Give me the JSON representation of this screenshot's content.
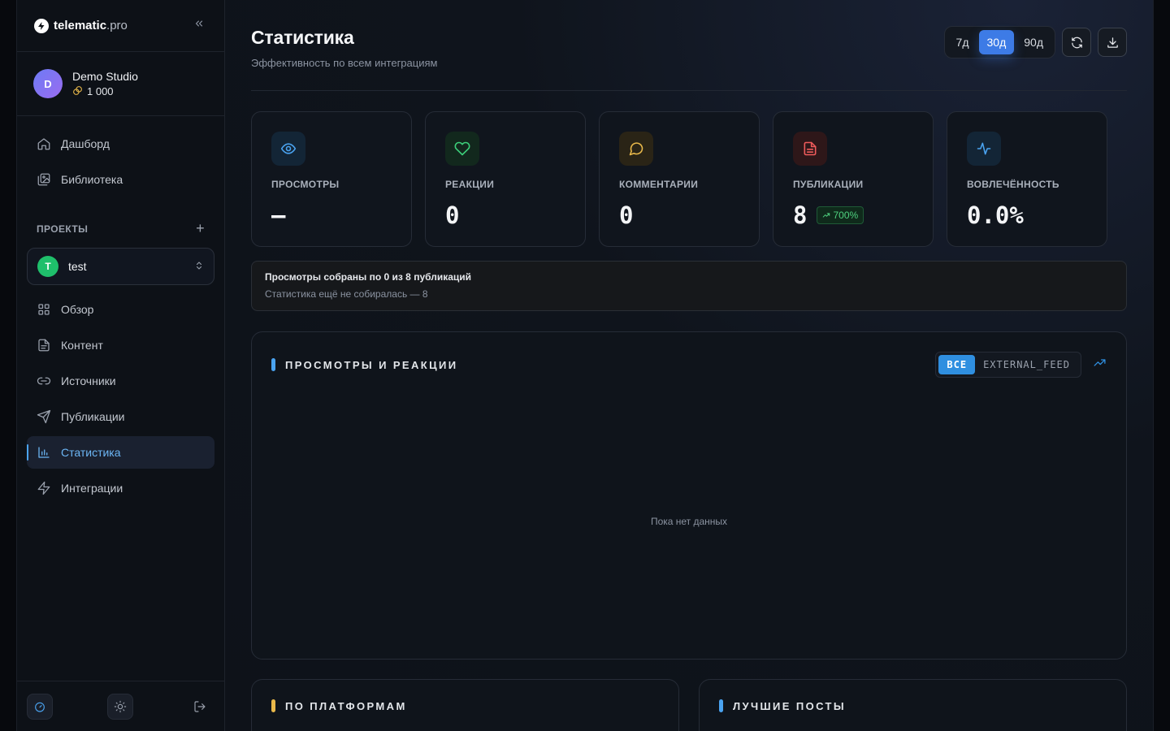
{
  "brand": {
    "name": "telematic",
    "suffix": ".pro"
  },
  "studio": {
    "initial": "D",
    "name": "Demo Studio",
    "credits": "1 000"
  },
  "nav_top": [
    {
      "label": "Дашборд",
      "icon": "home-icon"
    },
    {
      "label": "Библиотека",
      "icon": "image-library-icon"
    }
  ],
  "projects": {
    "heading": "ПРОЕКТЫ",
    "current_initial": "T",
    "current_name": "test"
  },
  "nav_project": [
    {
      "label": "Обзор",
      "icon": "grid-icon"
    },
    {
      "label": "Контент",
      "icon": "document-icon"
    },
    {
      "label": "Источники",
      "icon": "link-icon"
    },
    {
      "label": "Публикации",
      "icon": "send-icon"
    },
    {
      "label": "Статистика",
      "icon": "bar-chart-icon",
      "active": true
    },
    {
      "label": "Интеграции",
      "icon": "zap-icon"
    }
  ],
  "header": {
    "title": "Статистика",
    "subtitle": "Эффективность по всем интеграциям",
    "periods": [
      "7д",
      "30д",
      "90д"
    ],
    "active_period": "30д"
  },
  "stats": [
    {
      "label": "ПРОСМОТРЫ",
      "value": "—",
      "icon": "eye-icon",
      "color": "#4aa3f0"
    },
    {
      "label": "РЕАКЦИИ",
      "value": "0",
      "icon": "heart-icon",
      "color": "#3ccf7a"
    },
    {
      "label": "КОММЕНТАРИИ",
      "value": "0",
      "icon": "message-icon",
      "color": "#e8b84a"
    },
    {
      "label": "ПУБЛИКАЦИИ",
      "value": "8",
      "icon": "file-text-icon",
      "color": "#ef5b5b",
      "badge": "700%"
    },
    {
      "label": "ВОВЛЕЧЁННОСТЬ",
      "value": "0.0%",
      "icon": "activity-icon",
      "color": "#4aa3f0"
    }
  ],
  "notice": {
    "title": "Просмотры собраны по 0 из 8 публикаций",
    "text": "Статистика ещё не собиралась — 8"
  },
  "chart_panel": {
    "title": "ПРОСМОТРЫ И РЕАКЦИИ",
    "filters": [
      "ВСЕ",
      "EXTERNAL_FEED"
    ],
    "active_filter": "ВСЕ",
    "empty_text": "Пока нет данных"
  },
  "bottom_panels": [
    {
      "title": "ПО ПЛАТФОРМАМ",
      "color": "#e8b84a"
    },
    {
      "title": "ЛУЧШИЕ ПОСТЫ",
      "color": "#4aa3f0"
    }
  ]
}
